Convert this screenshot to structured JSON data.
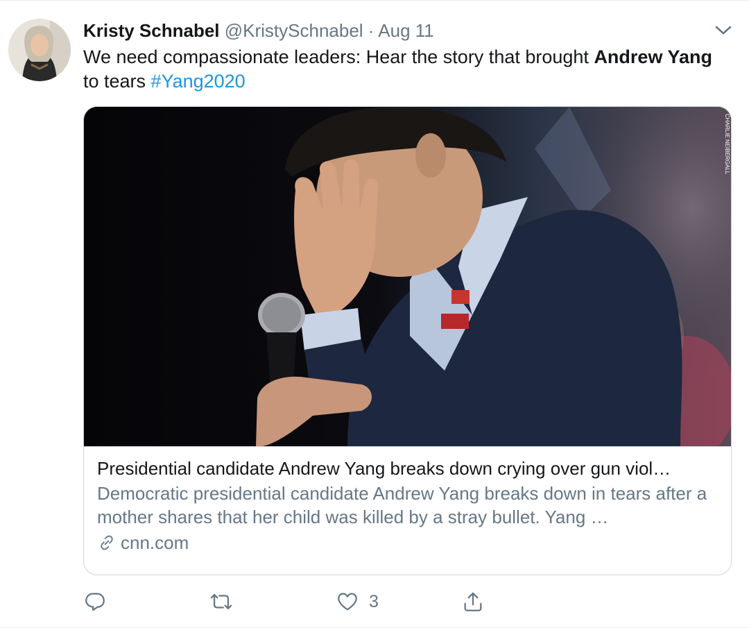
{
  "tweet": {
    "author_name": "Kristy Schnabel",
    "handle": "@KristySchnabel",
    "separator": "·",
    "date": "Aug 11",
    "text_part1": "We need compassionate leaders: Hear the story that brought ",
    "text_bold": "Andrew Yang",
    "text_part2": " to tears ",
    "hashtag": "#Yang2020"
  },
  "card": {
    "title": "Presidential candidate Andrew Yang breaks down crying over gun viol…",
    "description": "Democratic presidential candidate Andrew Yang breaks down in tears after a mother shares that her child was killed by a stray bullet. Yang …",
    "domain": "cnn.com",
    "photo_credit": "CHARLIE NEIBERGALL"
  },
  "actions": {
    "reply_count": "",
    "retweet_count": "",
    "like_count": "3"
  },
  "icons": [
    "chevron-down-icon",
    "link-icon",
    "reply-icon",
    "retweet-icon",
    "like-icon",
    "share-icon"
  ],
  "colors": {
    "link_blue": "#1b95e0",
    "secondary_gray": "#657786",
    "border": "#ccd6dd"
  }
}
